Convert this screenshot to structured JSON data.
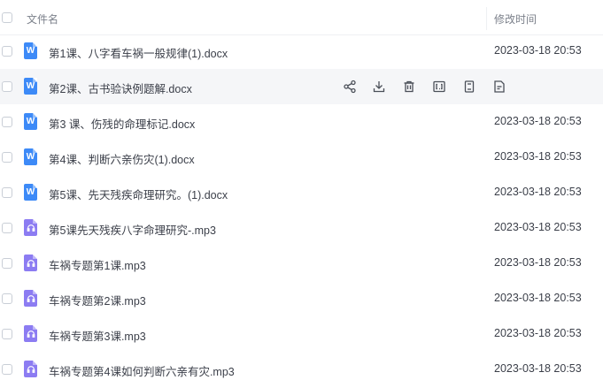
{
  "header": {
    "name_label": "文件名",
    "time_label": "修改时间"
  },
  "files": [
    {
      "name": "第1课、八字看车祸一般规律(1).docx",
      "type": "docx",
      "icon": "W",
      "time": "2023-03-18 20:53"
    },
    {
      "name": "第2课、古书验诀例题解.docx",
      "type": "docx",
      "icon": "W",
      "time": ""
    },
    {
      "name": "第3 课、伤残的命理标记.docx",
      "type": "docx",
      "icon": "W",
      "time": "2023-03-18 20:53"
    },
    {
      "name": "第4课、判断六亲伤灾(1).docx",
      "type": "docx",
      "icon": "W",
      "time": "2023-03-18 20:53"
    },
    {
      "name": "第5课、先天残疾命理研究。(1).docx",
      "type": "docx",
      "icon": "W",
      "time": "2023-03-18 20:53"
    },
    {
      "name": "第5课先天残疾八字命理研究-.mp3",
      "type": "mp3",
      "icon": "headphones",
      "time": "2023-03-18 20:53"
    },
    {
      "name": "车祸专题第1课.mp3",
      "type": "mp3",
      "icon": "headphones",
      "time": "2023-03-18 20:53"
    },
    {
      "name": "车祸专题第2课.mp3",
      "type": "mp3",
      "icon": "headphones",
      "time": "2023-03-18 20:53"
    },
    {
      "name": "车祸专题第3课.mp3",
      "type": "mp3",
      "icon": "headphones",
      "time": "2023-03-18 20:53"
    },
    {
      "name": "车祸专题第4课如何判断六亲有灾.mp3",
      "type": "mp3",
      "icon": "headphones",
      "time": "2023-03-18 20:53"
    }
  ],
  "hover_actions": [
    "share-icon",
    "download-icon",
    "delete-icon",
    "rename-icon",
    "copy-icon",
    "detail-icon"
  ],
  "colors": {
    "docx_icon": "#3d8af7",
    "mp3_icon": "#8c7cf2",
    "hover_row": "#f5f6f8",
    "text": "#3b3f49",
    "header_text": "#7c818b"
  }
}
